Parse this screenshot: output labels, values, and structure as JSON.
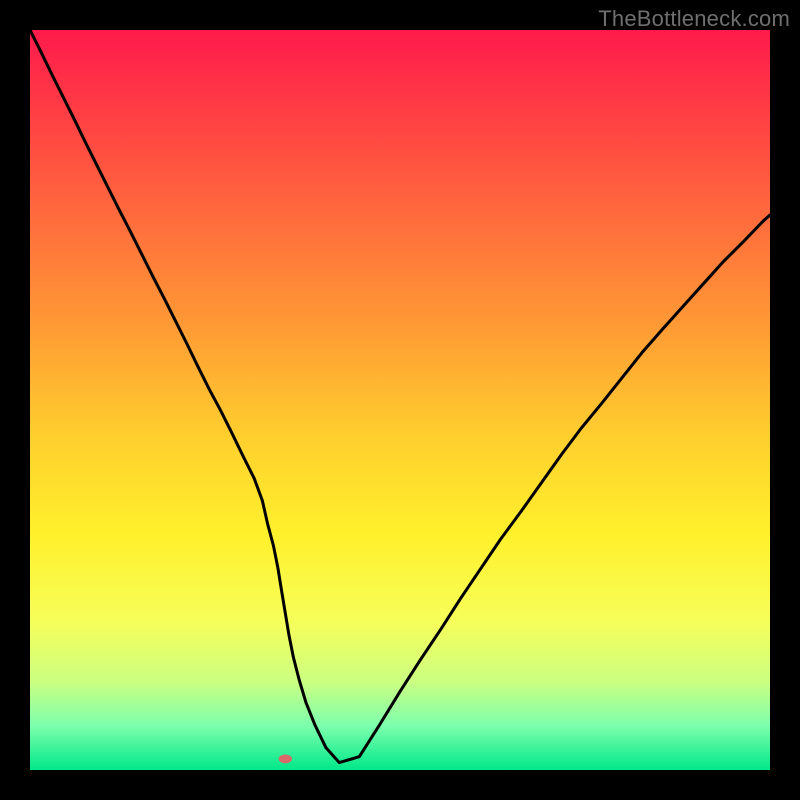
{
  "watermark": "TheBottleneck.com",
  "chart_data": {
    "type": "line",
    "title": "",
    "xlabel": "",
    "ylabel": "",
    "xlim": [
      0,
      100
    ],
    "ylim": [
      0,
      100
    ],
    "grid": false,
    "legend": false,
    "background_gradient": {
      "stops": [
        {
          "offset": 0.0,
          "color": "#ff1a4b"
        },
        {
          "offset": 0.1,
          "color": "#ff3a45"
        },
        {
          "offset": 0.25,
          "color": "#ff6a3d"
        },
        {
          "offset": 0.4,
          "color": "#ff9a35"
        },
        {
          "offset": 0.55,
          "color": "#ffcf2e"
        },
        {
          "offset": 0.68,
          "color": "#fff02b"
        },
        {
          "offset": 0.8,
          "color": "#f6ff5a"
        },
        {
          "offset": 0.88,
          "color": "#ccff81"
        },
        {
          "offset": 0.94,
          "color": "#7dffad"
        },
        {
          "offset": 1.0,
          "color": "#00e88a"
        }
      ]
    },
    "series": [
      {
        "name": "bottleneck-curve",
        "color": "#000000",
        "x": [
          0,
          1.5,
          3,
          4.5,
          6,
          7.5,
          9,
          10.5,
          12,
          13.6,
          15.1,
          16.6,
          18.2,
          19.7,
          21.2,
          22.7,
          24.2,
          25.8,
          27.3,
          28.8,
          30.3,
          31.4,
          32.1,
          32.9,
          33.5,
          34.0,
          34.5,
          35.0,
          35.6,
          36.4,
          37.3,
          38.5,
          40.0,
          41.8,
          44.5,
          47.3,
          50.0,
          52.7,
          55.5,
          58.2,
          60.9,
          63.6,
          66.4,
          69.1,
          71.8,
          74.5,
          77.3,
          80.0,
          82.7,
          85.5,
          88.2,
          90.9,
          93.6,
          96.4,
          99.1,
          100
        ],
        "y": [
          100,
          97.0,
          93.9,
          90.9,
          87.9,
          84.8,
          81.8,
          78.8,
          75.8,
          72.7,
          69.7,
          66.7,
          63.6,
          60.6,
          57.6,
          54.5,
          51.5,
          48.5,
          45.5,
          42.4,
          39.4,
          36.4,
          33.3,
          30.3,
          27.3,
          24.2,
          21.2,
          18.2,
          15.2,
          12.1,
          9.1,
          6.1,
          3.0,
          1.0,
          1.8,
          6.2,
          10.6,
          14.8,
          19.0,
          23.2,
          27.2,
          31.2,
          35.0,
          38.8,
          42.6,
          46.2,
          49.6,
          53.0,
          56.4,
          59.6,
          62.6,
          65.6,
          68.6,
          71.4,
          74.2,
          75.0
        ]
      }
    ],
    "marker": {
      "name": "optimal-point",
      "x": 34.5,
      "y": 1.5,
      "color": "#d96a6a",
      "rx": 0.9,
      "ry": 0.6
    }
  }
}
